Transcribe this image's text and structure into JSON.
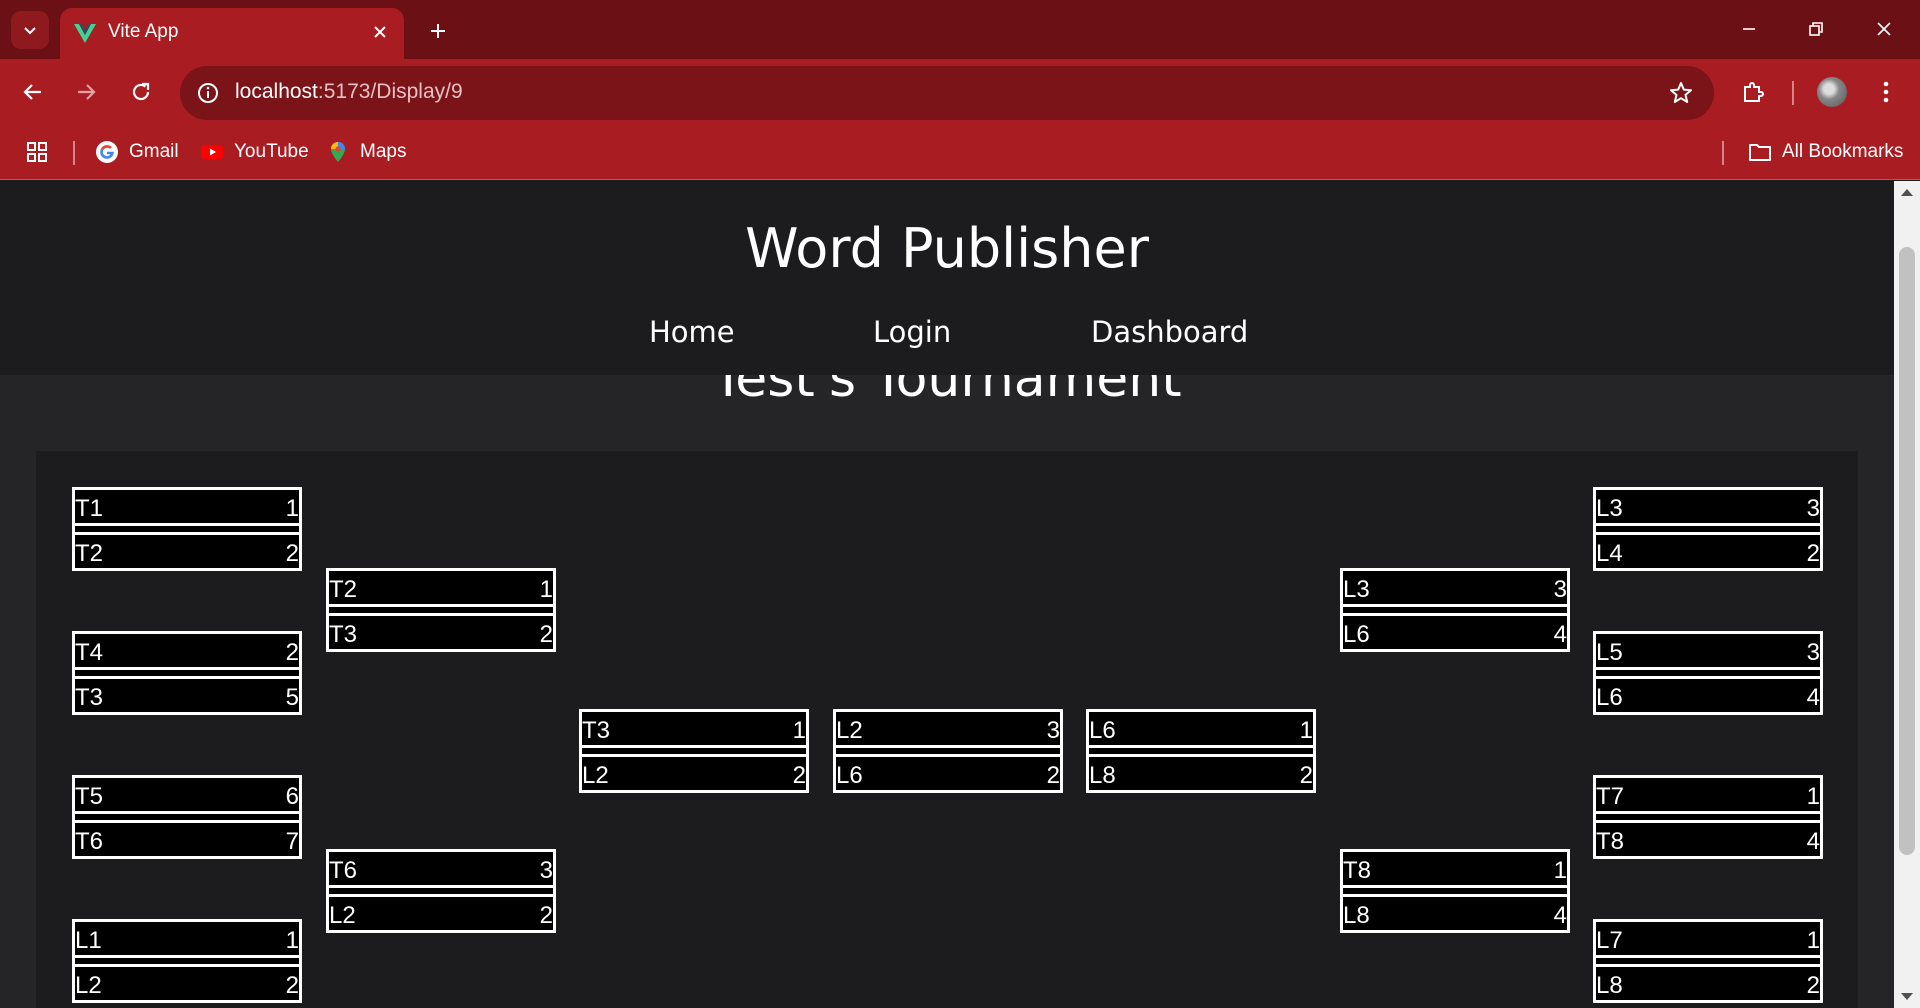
{
  "browser": {
    "tab_title": "Vite App",
    "url_host": "localhost",
    "url_path": ":5173/Display/9",
    "bookmarks": [
      "Gmail",
      "YouTube",
      "Maps"
    ],
    "all_bookmarks": "All Bookmarks"
  },
  "site": {
    "title": "Word Publisher",
    "nav": [
      "Home",
      "Login",
      "Dashboard"
    ]
  },
  "tournament": {
    "title": "Test's Tournament",
    "matches": [
      {
        "id": "r1-1",
        "teams": [
          {
            "name": "T1",
            "score": "1"
          },
          {
            "name": "T2",
            "score": "2"
          }
        ]
      },
      {
        "id": "r1-2",
        "teams": [
          {
            "name": "T4",
            "score": "2"
          },
          {
            "name": "T3",
            "score": "5"
          }
        ]
      },
      {
        "id": "r1-3",
        "teams": [
          {
            "name": "T5",
            "score": "6"
          },
          {
            "name": "T6",
            "score": "7"
          }
        ]
      },
      {
        "id": "r1-4",
        "teams": [
          {
            "name": "L1",
            "score": "1"
          },
          {
            "name": "L2",
            "score": "2"
          }
        ]
      },
      {
        "id": "r2-1",
        "teams": [
          {
            "name": "T2",
            "score": "1"
          },
          {
            "name": "T3",
            "score": "2"
          }
        ]
      },
      {
        "id": "r2-2",
        "teams": [
          {
            "name": "T6",
            "score": "3"
          },
          {
            "name": "L2",
            "score": "2"
          }
        ]
      },
      {
        "id": "r3-1",
        "teams": [
          {
            "name": "T3",
            "score": "1"
          },
          {
            "name": "L2",
            "score": "2"
          }
        ]
      },
      {
        "id": "final",
        "teams": [
          {
            "name": "L2",
            "score": "3"
          },
          {
            "name": "L6",
            "score": "2"
          }
        ]
      },
      {
        "id": "r3-2",
        "teams": [
          {
            "name": "L6",
            "score": "1"
          },
          {
            "name": "L8",
            "score": "2"
          }
        ]
      },
      {
        "id": "r2-3",
        "teams": [
          {
            "name": "L3",
            "score": "3"
          },
          {
            "name": "L6",
            "score": "4"
          }
        ]
      },
      {
        "id": "r2-4",
        "teams": [
          {
            "name": "T8",
            "score": "1"
          },
          {
            "name": "L8",
            "score": "4"
          }
        ]
      },
      {
        "id": "r1-5",
        "teams": [
          {
            "name": "L3",
            "score": "3"
          },
          {
            "name": "L4",
            "score": "2"
          }
        ]
      },
      {
        "id": "r1-6",
        "teams": [
          {
            "name": "L5",
            "score": "3"
          },
          {
            "name": "L6",
            "score": "4"
          }
        ]
      },
      {
        "id": "r1-7",
        "teams": [
          {
            "name": "T7",
            "score": "1"
          },
          {
            "name": "T8",
            "score": "4"
          }
        ]
      },
      {
        "id": "r1-8",
        "teams": [
          {
            "name": "L7",
            "score": "1"
          },
          {
            "name": "L8",
            "score": "2"
          }
        ]
      }
    ]
  }
}
